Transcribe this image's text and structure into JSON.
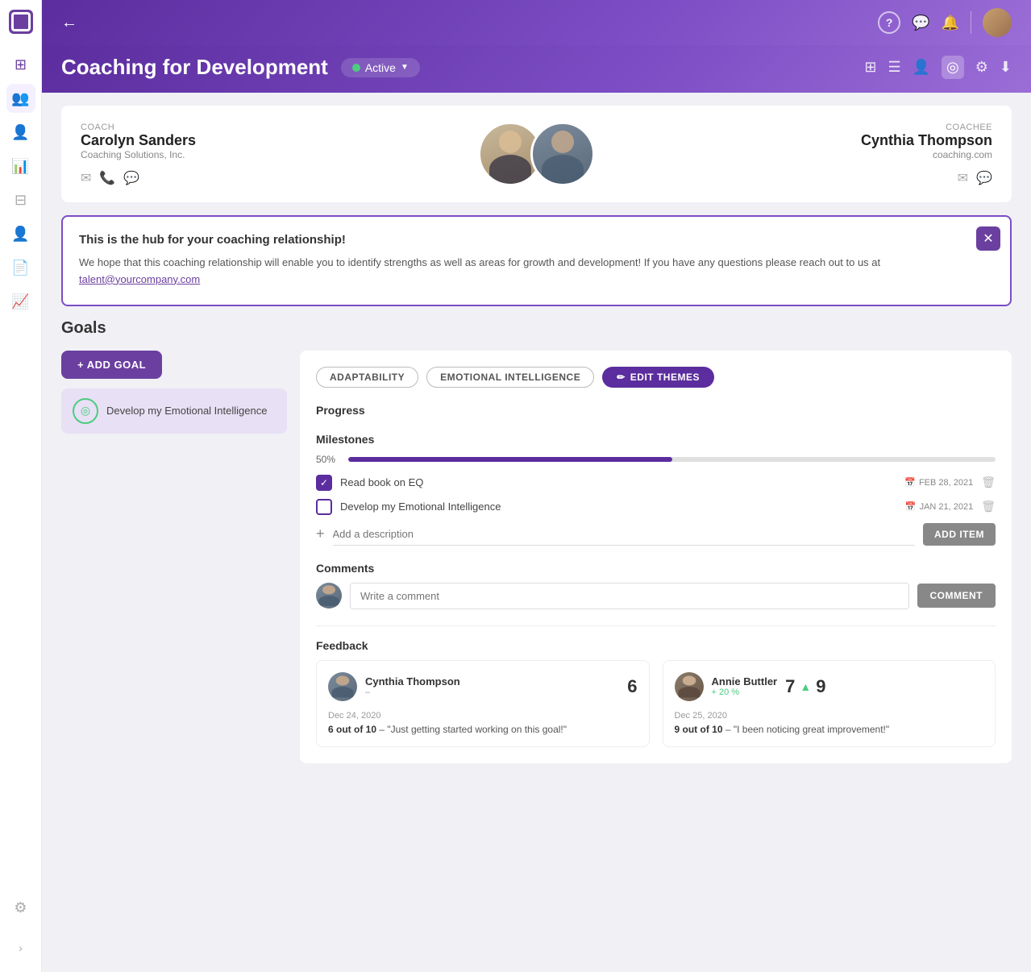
{
  "sidebar": {
    "items": [
      {
        "id": "home",
        "icon": "⊞",
        "active": false
      },
      {
        "id": "people",
        "icon": "👥",
        "active": true
      },
      {
        "id": "person",
        "icon": "👤",
        "active": false
      },
      {
        "id": "analytics",
        "icon": "📊",
        "active": false
      },
      {
        "id": "table",
        "icon": "⊟",
        "active": false
      },
      {
        "id": "profile",
        "icon": "📋",
        "active": false
      },
      {
        "id": "notes",
        "icon": "📄",
        "active": false
      },
      {
        "id": "chart",
        "icon": "📈",
        "active": false
      }
    ],
    "settings_icon": "⚙",
    "expand_icon": "›"
  },
  "header": {
    "back_icon": "←",
    "help_icon": "?",
    "chat_icon": "💬",
    "bell_icon": "🔔",
    "title": "Coaching for Development"
  },
  "page": {
    "title": "Coaching for Development",
    "status": "Active",
    "icons": {
      "grid": "⊞",
      "list": "☰",
      "person": "👤",
      "target": "◎",
      "settings": "⚙",
      "download": "⬇"
    }
  },
  "coach": {
    "label": "Coach",
    "name": "Carolyn Sanders",
    "company": "Coaching Solutions, Inc.",
    "icons": [
      "✉",
      "📞",
      "💬"
    ]
  },
  "coachee": {
    "label": "Coachee",
    "name": "Cynthia Thompson",
    "company": "coaching.com",
    "icons": [
      "✉",
      "💬"
    ]
  },
  "info_box": {
    "title": "This is the hub for your coaching relationship!",
    "text": "We hope that this coaching relationship will enable you to identify strengths as well as areas for growth and development! If you have any questions please reach out to us at",
    "link_text": "talent@yourcompany.com",
    "close_icon": "✕"
  },
  "goals": {
    "section_title": "Goals",
    "add_button": "+ ADD GOAL",
    "list": [
      {
        "id": 1,
        "label": "Develop my Emotional Intelligence",
        "active": true
      }
    ],
    "themes": [
      {
        "label": "ADAPTABILITY"
      },
      {
        "label": "EMOTIONAL INTELLIGENCE"
      }
    ],
    "edit_themes_btn": "EDIT THEMES",
    "progress": {
      "label": "Progress",
      "percent": 50,
      "fill_width": "50%"
    },
    "milestones": {
      "label": "Milestones",
      "items": [
        {
          "text": "Read book on EQ",
          "checked": true,
          "date": "FEB 28, 2021"
        },
        {
          "text": "Develop my Emotional Intelligence",
          "checked": false,
          "date": "JAN 21, 2021"
        }
      ],
      "add_placeholder": "Add a description",
      "add_item_btn": "ADD ITEM"
    },
    "comments": {
      "label": "Comments",
      "placeholder": "Write a comment",
      "btn": "COMMENT"
    },
    "feedback": {
      "label": "Feedback",
      "cards": [
        {
          "name": "Cynthia Thompson",
          "sub": "–",
          "score": "6",
          "date": "Dec 24, 2020",
          "detail": "6 out of 10",
          "quote": "\"Just getting started working on this goal!\""
        },
        {
          "name": "Annie Buttler",
          "sub": "+ 20 %",
          "score_left": "7",
          "score_right": "9",
          "arrow": "▲",
          "date": "Dec 25, 2020",
          "detail": "9 out of 10",
          "quote": "\"I been noticing great improvement!\""
        }
      ]
    }
  }
}
